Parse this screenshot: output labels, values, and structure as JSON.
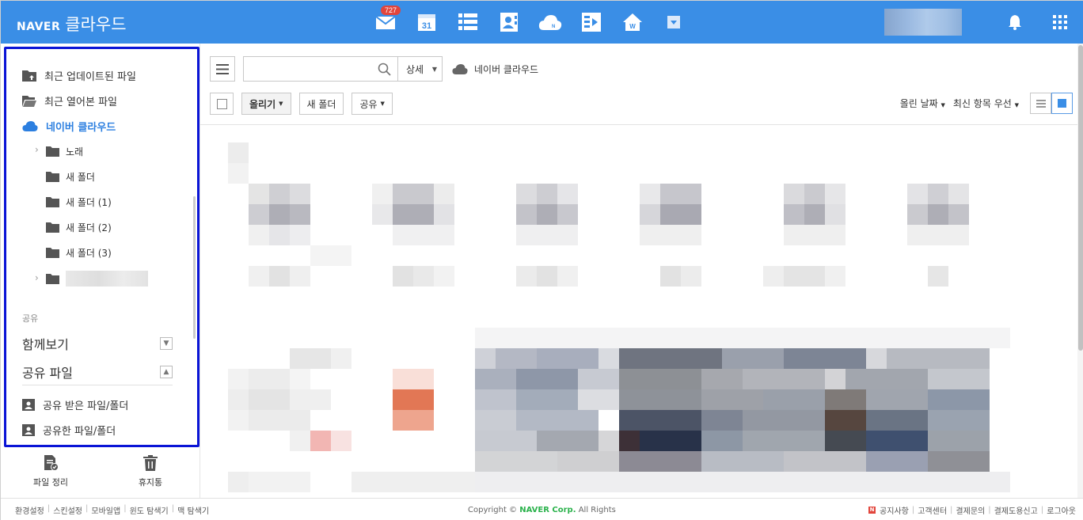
{
  "header": {
    "brand": "NAVER",
    "product": "클라우드",
    "mail_badge": "727",
    "calendar_day": "31"
  },
  "sidebar": {
    "items": [
      {
        "label": "최근 업데이트된 파일"
      },
      {
        "label": "최근 열어본 파일"
      },
      {
        "label": "네이버 클라우드"
      }
    ],
    "tree": [
      {
        "label": "노래"
      },
      {
        "label": "새 폴더"
      },
      {
        "label": "새 폴더 (1)"
      },
      {
        "label": "새 폴더 (2)"
      },
      {
        "label": "새 폴더 (3)"
      }
    ],
    "share_section": "공유",
    "together_label": "함께보기",
    "shared_files_label": "공유 파일",
    "shared_items": [
      {
        "label": "공유 받은 파일/폴더"
      },
      {
        "label": "공유한 파일/폴더"
      }
    ],
    "tools": {
      "organize": "파일 정리",
      "trash": "휴지통"
    }
  },
  "toolbar": {
    "search_placeholder": "",
    "detail_label": "상세",
    "breadcrumb": "네이버 클라우드",
    "upload": "올리기",
    "new_folder": "새 폴더",
    "share": "공유",
    "sort_date": "올린 날짜",
    "sort_order": "최신 항목 우선"
  },
  "footer": {
    "left": [
      "환경설정",
      "스킨설정",
      "모바일앱",
      "윈도 탐색기",
      "맥 탐색기"
    ],
    "copyright_prefix": "Copyright ©",
    "corp": "NAVER Corp.",
    "rights": "All Rights",
    "right": [
      "공지사항",
      "고객센터",
      "결제문의",
      "결제도용신고",
      "로그아웃"
    ]
  },
  "colors": {
    "header_bg": "#3a8ee6",
    "active": "#2c7fe0",
    "highlight_border": "#0a14d6"
  }
}
